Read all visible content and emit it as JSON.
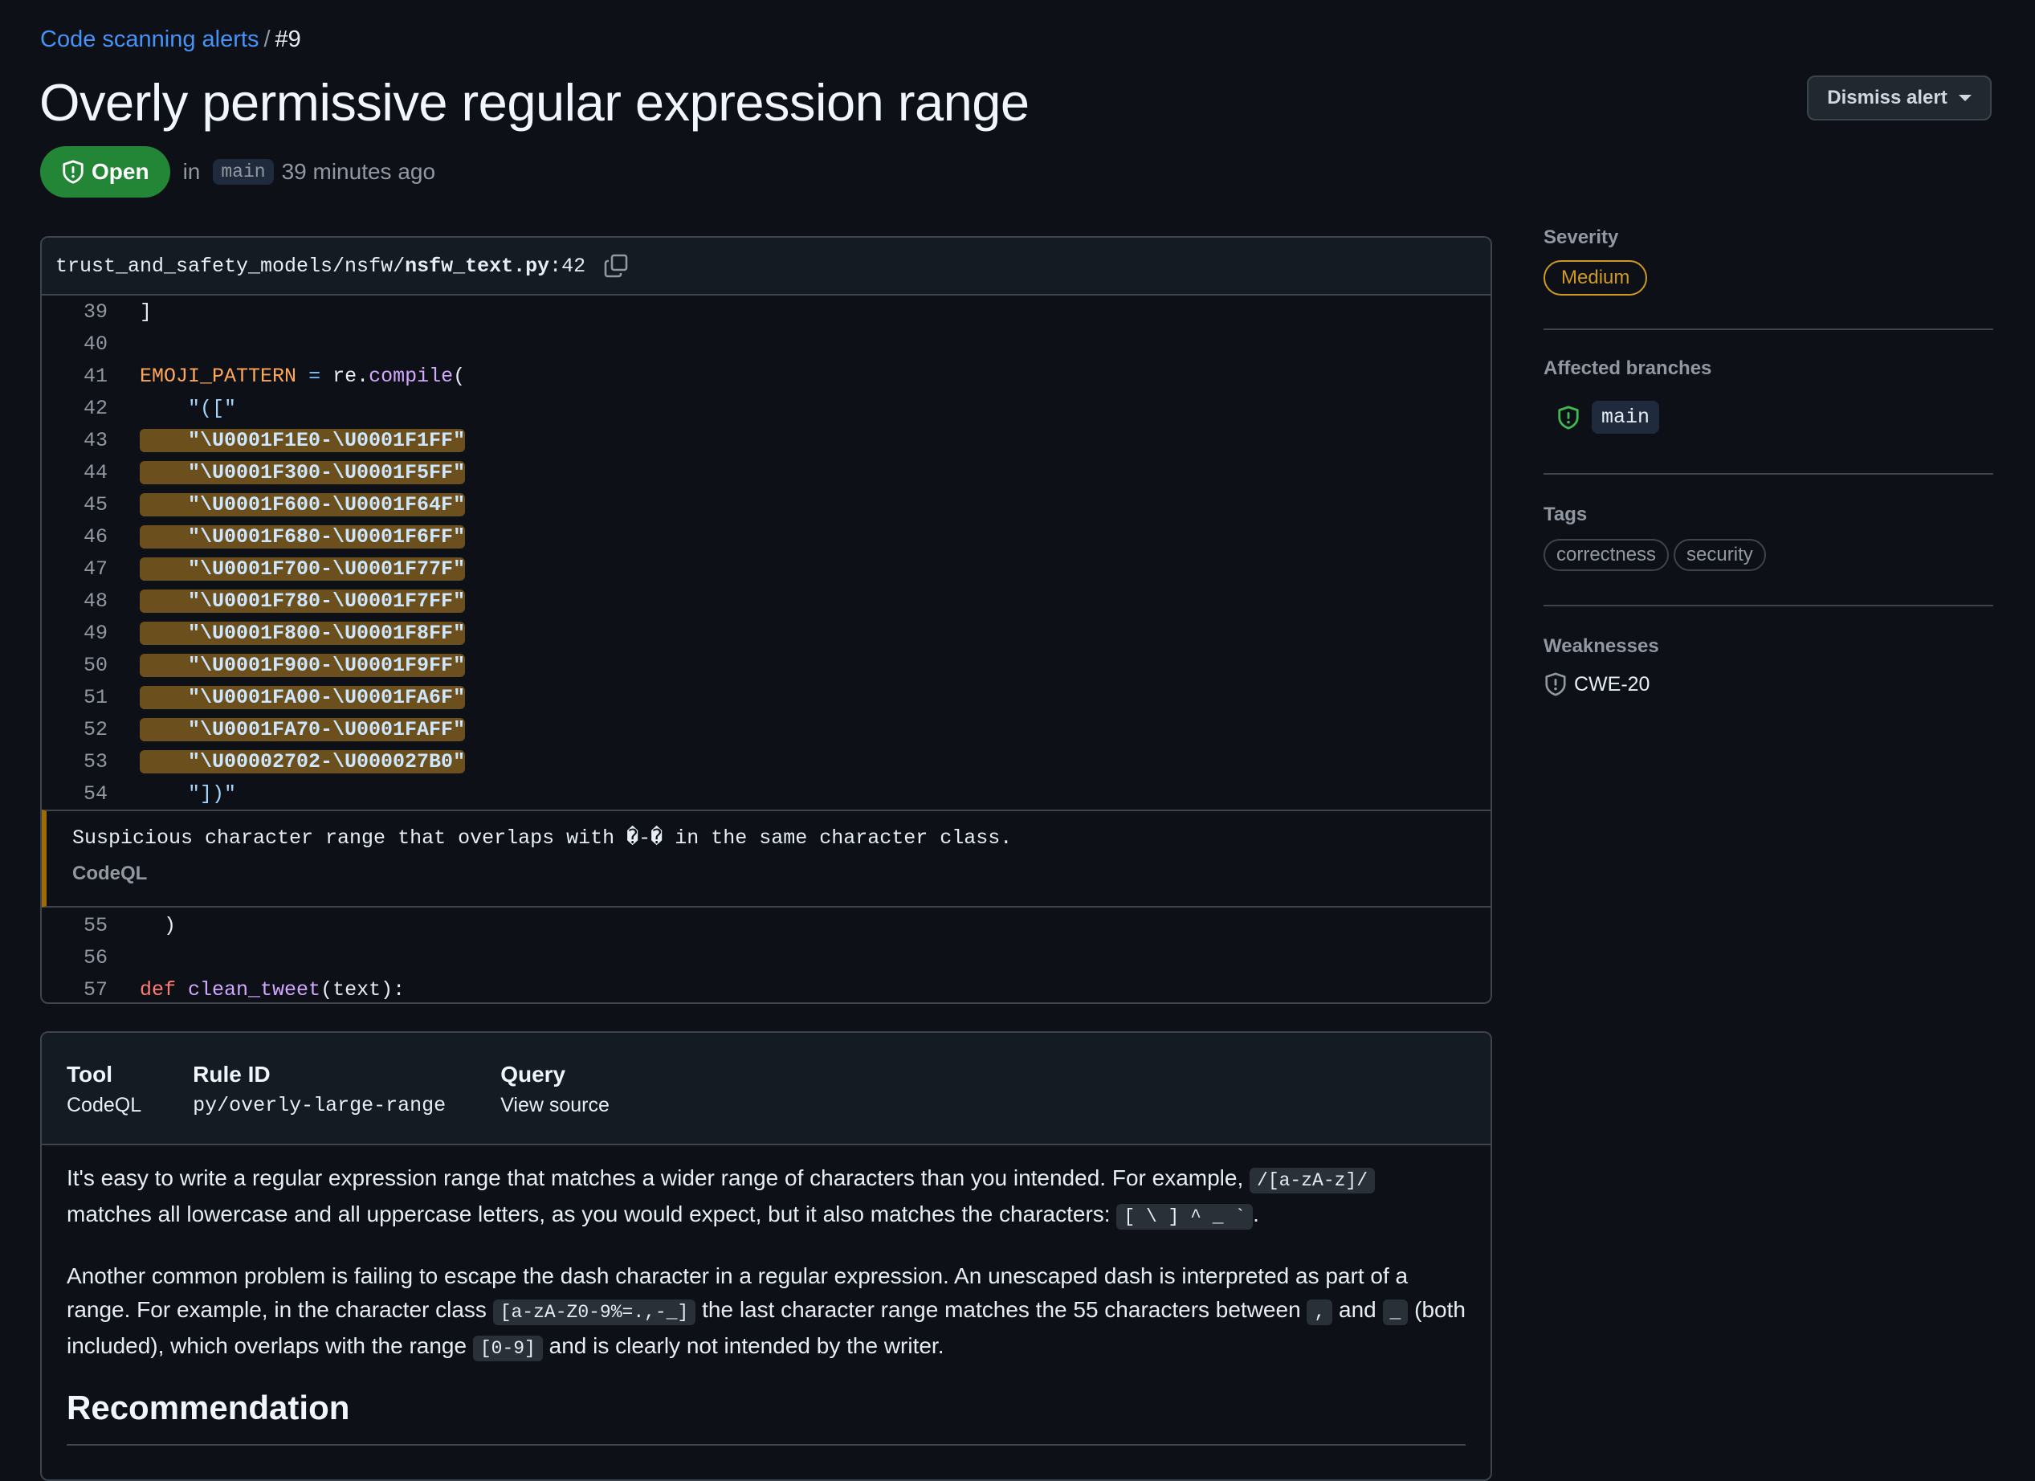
{
  "breadcrumb": {
    "parent": "Code scanning alerts",
    "separator": "/",
    "current": "#9"
  },
  "title": "Overly permissive regular expression range",
  "actions": {
    "dismiss": "Dismiss alert"
  },
  "status": {
    "state": "Open",
    "in_label": "in",
    "branch": "main",
    "time": "39 minutes ago"
  },
  "code": {
    "path_prefix": "trust_and_safety_models/nsfw/",
    "file": "nsfw_text.py",
    "line_suffix": ":42",
    "lines_before": [
      {
        "n": "39",
        "t": "]"
      },
      {
        "n": "40",
        "t": ""
      },
      {
        "n": "41",
        "t": "EMOJI_PATTERN = re.compile("
      },
      {
        "n": "42",
        "t": "    \"([\""
      },
      {
        "n": "43",
        "t": "    \"\\U0001F1E0-\\U0001F1FF\""
      },
      {
        "n": "44",
        "t": "    \"\\U0001F300-\\U0001F5FF\""
      },
      {
        "n": "45",
        "t": "    \"\\U0001F600-\\U0001F64F\""
      },
      {
        "n": "46",
        "t": "    \"\\U0001F680-\\U0001F6FF\""
      },
      {
        "n": "47",
        "t": "    \"\\U0001F700-\\U0001F77F\""
      },
      {
        "n": "48",
        "t": "    \"\\U0001F780-\\U0001F7FF\""
      },
      {
        "n": "49",
        "t": "    \"\\U0001F800-\\U0001F8FF\""
      },
      {
        "n": "50",
        "t": "    \"\\U0001F900-\\U0001F9FF\""
      },
      {
        "n": "51",
        "t": "    \"\\U0001FA00-\\U0001FA6F\""
      },
      {
        "n": "52",
        "t": "    \"\\U0001FA70-\\U0001FAFF\""
      },
      {
        "n": "53",
        "t": "    \"\\U00002702-\\U000027B0\""
      },
      {
        "n": "54",
        "t": "    \"])\""
      }
    ],
    "annotation": {
      "message": "Suspicious character range that overlaps with �-� in the same character class.",
      "tool": "CodeQL"
    },
    "lines_after": [
      {
        "n": "55",
        "t": "  )"
      },
      {
        "n": "56",
        "t": ""
      },
      {
        "n": "57",
        "t": "def clean_tweet(text):"
      }
    ]
  },
  "details": {
    "tool_label": "Tool",
    "tool_value": "CodeQL",
    "rule_label": "Rule ID",
    "rule_value": "py/overly-large-range",
    "query_label": "Query",
    "query_value": "View source",
    "p1_a": "It's easy to write a regular expression range that matches a wider range of characters than you intended. For example,",
    "p1_code1": "/[a-zA-z]/",
    "p1_b": "matches all lowercase and all uppercase letters, as you would expect, but it also matches the characters:",
    "p1_code2": "[ \\ ] ^ _ `",
    "p1_c": ".",
    "p2_a": "Another common problem is failing to escape the dash character in a regular expression. An unescaped dash is interpreted as part of a range. For example, in the character class",
    "p2_code1": "[a-zA-Z0-9%=.,-_]",
    "p2_b": "the last character range matches the 55 characters between",
    "p2_code2": ",",
    "p2_c": "and",
    "p2_code3": "_",
    "p2_d": "(both included), which overlaps with the range",
    "p2_code4": "[0-9]",
    "p2_e": "and is clearly not intended by the writer.",
    "recommendation": "Recommendation"
  },
  "sidebar": {
    "severity_label": "Severity",
    "severity": "Medium",
    "branches_label": "Affected branches",
    "branch": "main",
    "tags_label": "Tags",
    "tags": [
      "correctness",
      "security"
    ],
    "weaknesses_label": "Weaknesses",
    "weakness": "CWE-20"
  },
  "colors": {
    "open": "#238636",
    "medium": "#d29922",
    "highlight": "#6b4f1d",
    "link": "#4493f8"
  },
  "icons": [
    "shield-alert-icon",
    "copy-icon",
    "triangle-down-icon",
    "shield-check-icon",
    "shield-icon"
  ]
}
